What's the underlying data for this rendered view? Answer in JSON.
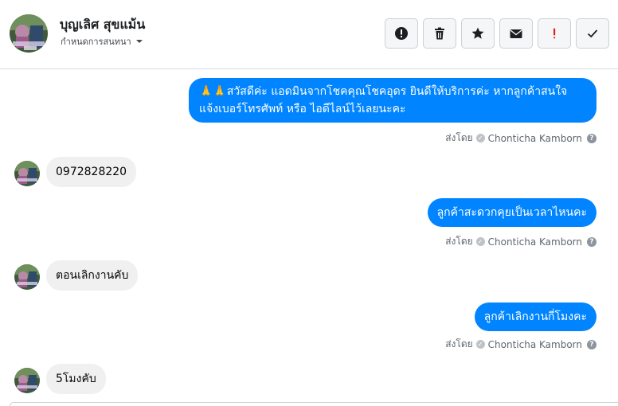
{
  "header": {
    "contact_name": "บุญเลิศ สุขแม้น",
    "subtitle": "กำหนดการสนทนา",
    "actions": [
      {
        "name": "report-button",
        "icon": "exclamation-circle-icon"
      },
      {
        "name": "delete-button",
        "icon": "trash-icon"
      },
      {
        "name": "star-button",
        "icon": "star-icon"
      },
      {
        "name": "mark-unread-button",
        "icon": "envelope-icon"
      },
      {
        "name": "mark-important-button",
        "icon": "exclamation-icon"
      },
      {
        "name": "mark-done-button",
        "icon": "check-icon"
      }
    ]
  },
  "messages": [
    {
      "direction": "out",
      "text_line1": "🙏🙏สวัสดีค่ะ แอดมินจากโชคคุณโชคอุดร ยินดีให้บริการค่ะ หากลูกค้าสนใจ",
      "text_line2": "แจ้งเบอร์โทรศัพท์ หรือ ไอดีไลน์ไว้เลยนะคะ",
      "sent_by_prefix": "ส่งโดย",
      "sent_by_name": "Chonticha Kamborn"
    },
    {
      "direction": "in",
      "text": "0972828220"
    },
    {
      "direction": "out",
      "text": "ลูกค้าสะดวกคุยเป็นเวลาไหนคะ",
      "sent_by_prefix": "ส่งโดย",
      "sent_by_name": "Chonticha Kamborn"
    },
    {
      "direction": "in",
      "text": "ตอนเลิกงานคับ"
    },
    {
      "direction": "out",
      "text": "ลูกค้าเลิกงานกี่โมงคะ",
      "sent_by_prefix": "ส่งโดย",
      "sent_by_name": "Chonticha Kamborn"
    },
    {
      "direction": "in",
      "text": "5โมงคับ"
    }
  ],
  "colors": {
    "outgoing_bubble": "#0084ff",
    "incoming_bubble": "#f0f0f0",
    "important_icon": "#e02020"
  }
}
